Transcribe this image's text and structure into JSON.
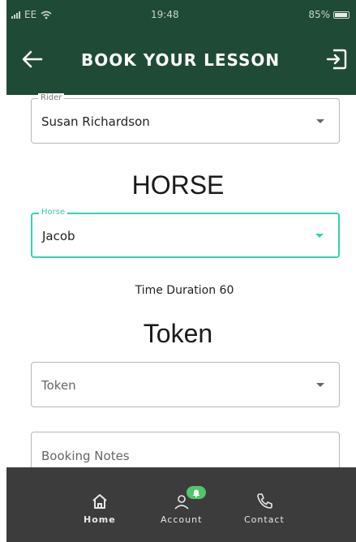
{
  "status_bar": {
    "carrier": "EE",
    "time": "19:48",
    "battery": "85%"
  },
  "appbar": {
    "title": "BOOK YOUR LESSON",
    "back_icon": "arrow-left-icon",
    "logout_icon": "logout-icon"
  },
  "form": {
    "rider": {
      "label": "Rider",
      "value": "Susan Richardson"
    },
    "horse_heading": "HORSE",
    "horse": {
      "label": "Horse",
      "value": "Jacob"
    },
    "time_duration": "Time Duration 60",
    "token_heading": "Token",
    "token": {
      "placeholder": "Token"
    },
    "notes": {
      "placeholder": "Booking Notes"
    }
  },
  "bottom_nav": {
    "items": [
      {
        "label": "Home",
        "icon": "home-icon",
        "active": true
      },
      {
        "label": "Account",
        "icon": "account-icon",
        "active": false
      },
      {
        "label": "Contact",
        "icon": "phone-icon",
        "active": false
      }
    ]
  },
  "colors": {
    "header": "#1f4a36",
    "accent": "#35d0b4",
    "badge": "#52c46b",
    "nav_bg": "#3c3c3c"
  }
}
